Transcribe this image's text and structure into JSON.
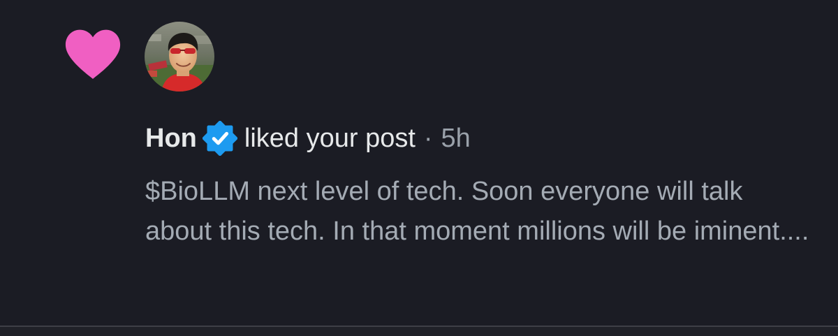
{
  "notification": {
    "type_icon": "heart-icon",
    "user": {
      "name": "Hon",
      "verified": true,
      "verified_icon": "verified-badge-icon",
      "avatar": "avatar-photo"
    },
    "action": "liked your post",
    "separator": "·",
    "time_ago": "5h",
    "post_text": "$BioLLM next level of tech. Soon everyone will talk about this tech. In that moment millions will be iminent...."
  },
  "colors": {
    "background": "#1b1c24",
    "heart": "#f05fc2",
    "verified_badge": "#1d9bf0",
    "primary_text": "#e7e9ea",
    "secondary_text": "#a4abb4",
    "divider": "#3e3f46"
  }
}
